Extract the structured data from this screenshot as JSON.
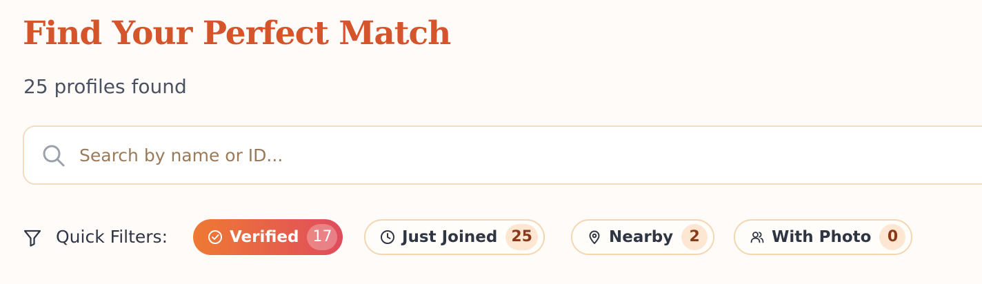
{
  "header": {
    "title": "Find Your Perfect Match",
    "subtitle": "25 profiles found"
  },
  "search": {
    "placeholder": "Search by name or ID...",
    "value": "",
    "icon": "search-icon"
  },
  "quick_filters": {
    "label": "Quick Filters:",
    "icon": "filter-icon",
    "chips": [
      {
        "label": "Verified",
        "count": "17",
        "icon": "check-circle-icon",
        "active": true
      },
      {
        "label": "Just Joined",
        "count": "25",
        "icon": "clock-icon",
        "active": false
      },
      {
        "label": "Nearby",
        "count": "2",
        "icon": "map-pin-icon",
        "active": false
      },
      {
        "label": "With Photo",
        "count": "0",
        "icon": "users-icon",
        "active": false
      }
    ]
  },
  "colors": {
    "title": "#d4552b",
    "background": "#fefbf9",
    "chip_border": "#f3d6b0",
    "count_bg": "#fde7d2",
    "active_gradient_start": "#ee7a33",
    "active_gradient_end": "#e04c5d"
  }
}
